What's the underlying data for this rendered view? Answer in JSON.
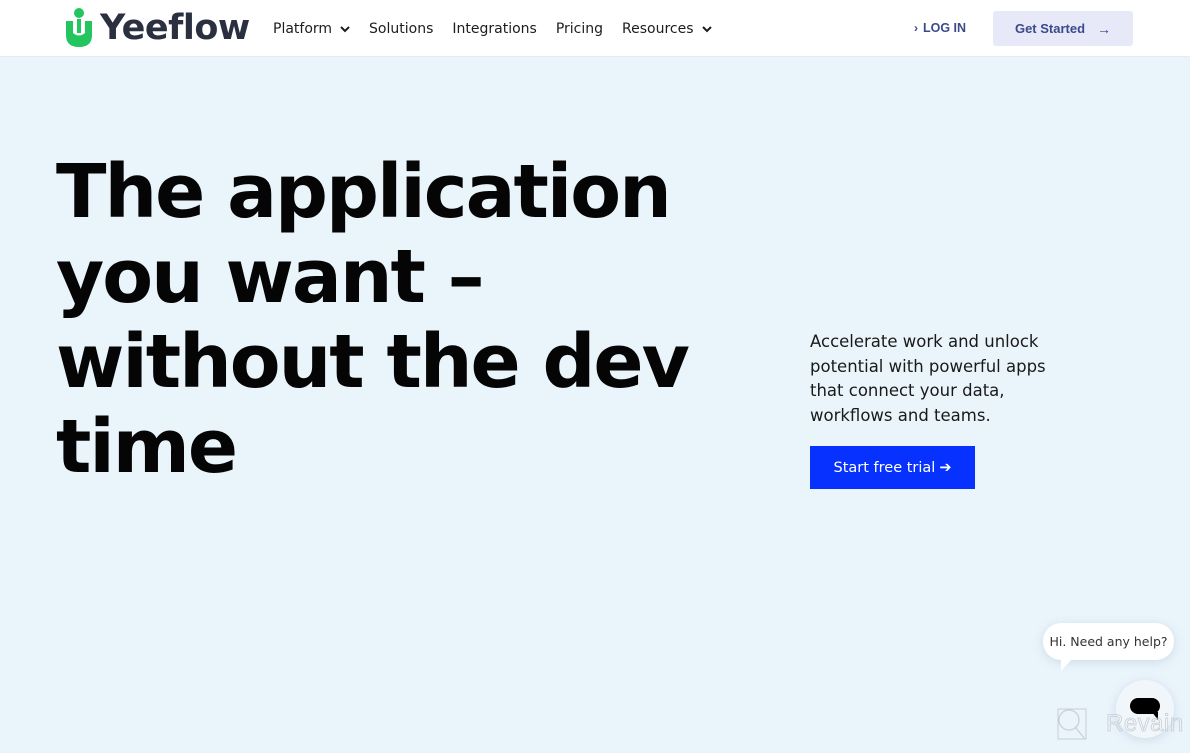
{
  "brand": {
    "name": "Yeeflow",
    "logo_color": "#22c55e",
    "icon": "yeeflow-logo-icon"
  },
  "nav": {
    "items": [
      {
        "label": "Platform",
        "has_dropdown": true
      },
      {
        "label": "Solutions",
        "has_dropdown": false
      },
      {
        "label": "Integrations",
        "has_dropdown": false
      },
      {
        "label": "Pricing",
        "has_dropdown": false
      },
      {
        "label": "Resources",
        "has_dropdown": true
      }
    ]
  },
  "header_actions": {
    "login_prefix": "›",
    "login_label": "LOG IN",
    "get_started_label": "Get Started",
    "get_started_arrow": "→"
  },
  "hero": {
    "title_lines": [
      "The application",
      "you want –",
      "without the dev",
      "time"
    ],
    "description": "Accelerate work and unlock potential with powerful apps that connect your data, workflows and teams.",
    "cta_label": "Start free trial",
    "cta_arrow": "➔",
    "cta_color": "#0731ff"
  },
  "chat": {
    "bubble_text": "Hi. Need any help?",
    "launcher_icon": "chat-icon"
  },
  "watermark": {
    "text": "Revain"
  },
  "colors": {
    "background": "#eaf4fb",
    "header_bg": "#ffffff",
    "nav_text": "#1d1d1d",
    "accent_text": "#3b4a8a",
    "get_started_bg": "#e7e9f9"
  }
}
